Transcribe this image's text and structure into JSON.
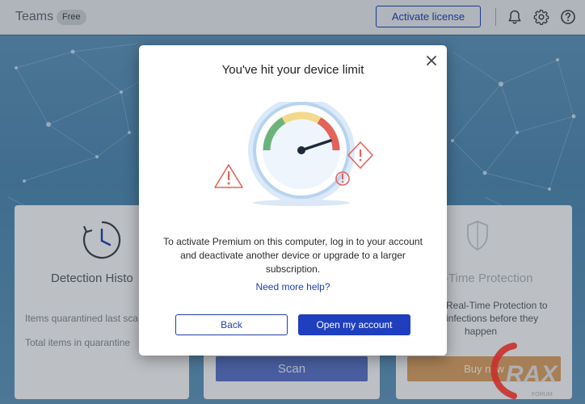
{
  "titlebar": {
    "app_name": "Teams",
    "plan_badge": "Free",
    "activate_label": "Activate license",
    "icons": [
      "bell-icon",
      "gear-icon",
      "help-icon"
    ]
  },
  "background": {
    "cards": {
      "left": {
        "title": "Detection Histo",
        "row1": "Items quarantined last sca",
        "row2": "Total items in quarantine",
        "icon": "clock-icon"
      },
      "middle": {
        "scan_label": "Scan"
      },
      "right": {
        "title": "-Time Protection",
        "desc_line1": "Real-Time Protection to",
        "desc_line2": "infections before they",
        "desc_line3": "happen",
        "buy_label": "Buy now",
        "icon": "shield-icon"
      }
    }
  },
  "dialog": {
    "title": "You've hit your device limit",
    "message": "To activate Premium on this computer, log in to your account and deactivate another device or upgrade to a larger subscription.",
    "help_link": "Need more help?",
    "back_label": "Back",
    "open_account_label": "Open my account",
    "illustration": "speedometer-warning-illustration"
  },
  "watermark": {
    "text": "CRAX",
    "subtext": "FORUM"
  },
  "colors": {
    "accent": "#1f3fbf",
    "titlebar_bg": "#dcdfe3",
    "background": "#4d83aa",
    "warning": "#e3635a"
  }
}
